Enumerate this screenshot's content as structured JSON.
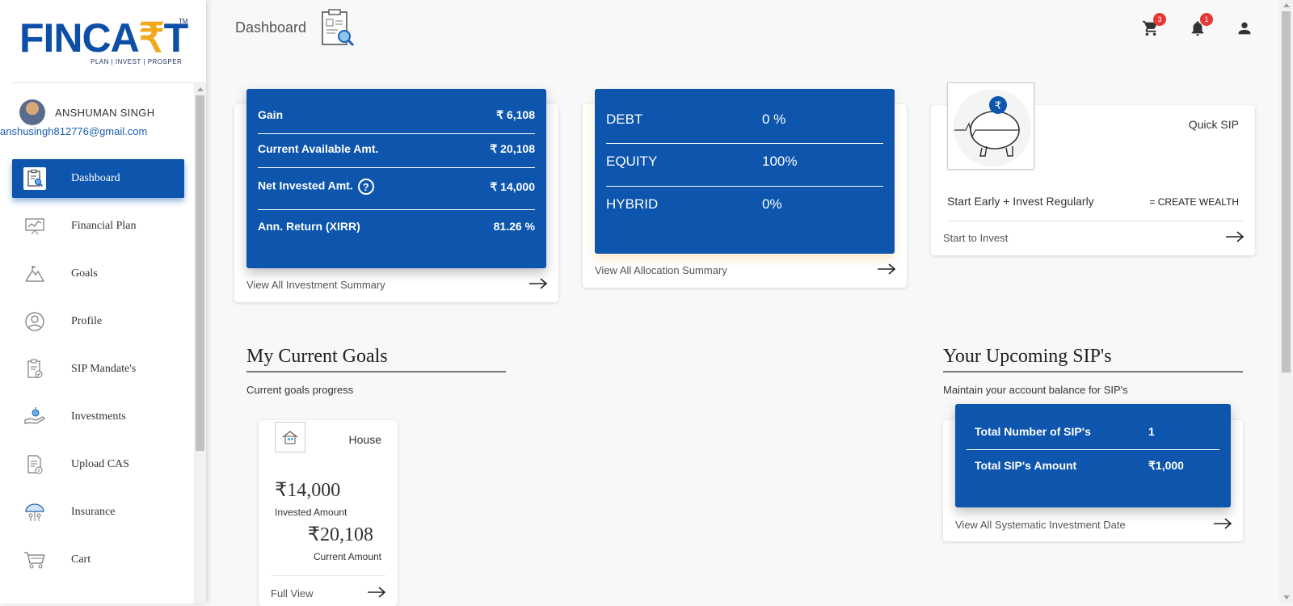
{
  "logo": {
    "text_left": "FINCA",
    "text_rupee": "₹",
    "text_right": "T",
    "tagline": "PLAN | INVEST | PROSPER",
    "tm": "TM"
  },
  "user": {
    "name": "ANSHUMAN SINGH",
    "email": "anshusingh812776@gmail.com"
  },
  "nav": [
    {
      "label": "Dashboard",
      "icon": "dashboard-icon"
    },
    {
      "label": "Financial Plan",
      "icon": "chart-board-icon"
    },
    {
      "label": "Goals",
      "icon": "mountain-flag-icon"
    },
    {
      "label": "Profile",
      "icon": "user-circle-icon"
    },
    {
      "label": "SIP Mandate's",
      "icon": "clipboard-check-icon"
    },
    {
      "label": "Investments",
      "icon": "hand-coin-icon"
    },
    {
      "label": "Upload CAS",
      "icon": "document-upload-icon"
    },
    {
      "label": "Insurance",
      "icon": "umbrella-family-icon"
    },
    {
      "label": "Cart",
      "icon": "cart-icon"
    }
  ],
  "header": {
    "title": "Dashboard",
    "cart_badge": "3",
    "notification_badge": "1"
  },
  "investment_summary": {
    "rows": [
      {
        "label": "Gain",
        "value": "₹ 6,108"
      },
      {
        "label": "Current Available Amt.",
        "value": "₹ 20,108"
      },
      {
        "label": "Net Invested Amt.",
        "value": "₹ 14,000"
      },
      {
        "label": "Ann. Return (XIRR)",
        "value": "81.26 %"
      }
    ],
    "help": "?",
    "link": "View All Investment Summary"
  },
  "allocation": {
    "rows": [
      {
        "label": "DEBT",
        "value": "0 %"
      },
      {
        "label": "EQUITY",
        "value": "100%"
      },
      {
        "label": "HYBRID",
        "value": "0%"
      }
    ],
    "link": "View All Allocation Summary"
  },
  "quick_sip": {
    "title": "Quick SIP",
    "tagline_left": "Start Early + Invest Regularly",
    "tagline_right": "= CREATE WEALTH",
    "link": "Start to Invest",
    "icon_symbol": "₹"
  },
  "goals": {
    "title": "My Current Goals",
    "subtitle": "Current goals progress",
    "items": [
      {
        "name": "House",
        "invested": "₹14,000",
        "invested_label": "Invested Amount",
        "current": "₹20,108",
        "current_label": "Current Amount",
        "link": "Full View"
      }
    ]
  },
  "upcoming_sip": {
    "title": "Your Upcoming SIP's",
    "subtitle": "Maintain your account balance for SIP's",
    "rows": [
      {
        "label": "Total Number of SIP's",
        "value": "1"
      },
      {
        "label": "Total SIP's Amount",
        "value": "₹1,000"
      }
    ],
    "link": "View All Systematic Investment Date"
  }
}
